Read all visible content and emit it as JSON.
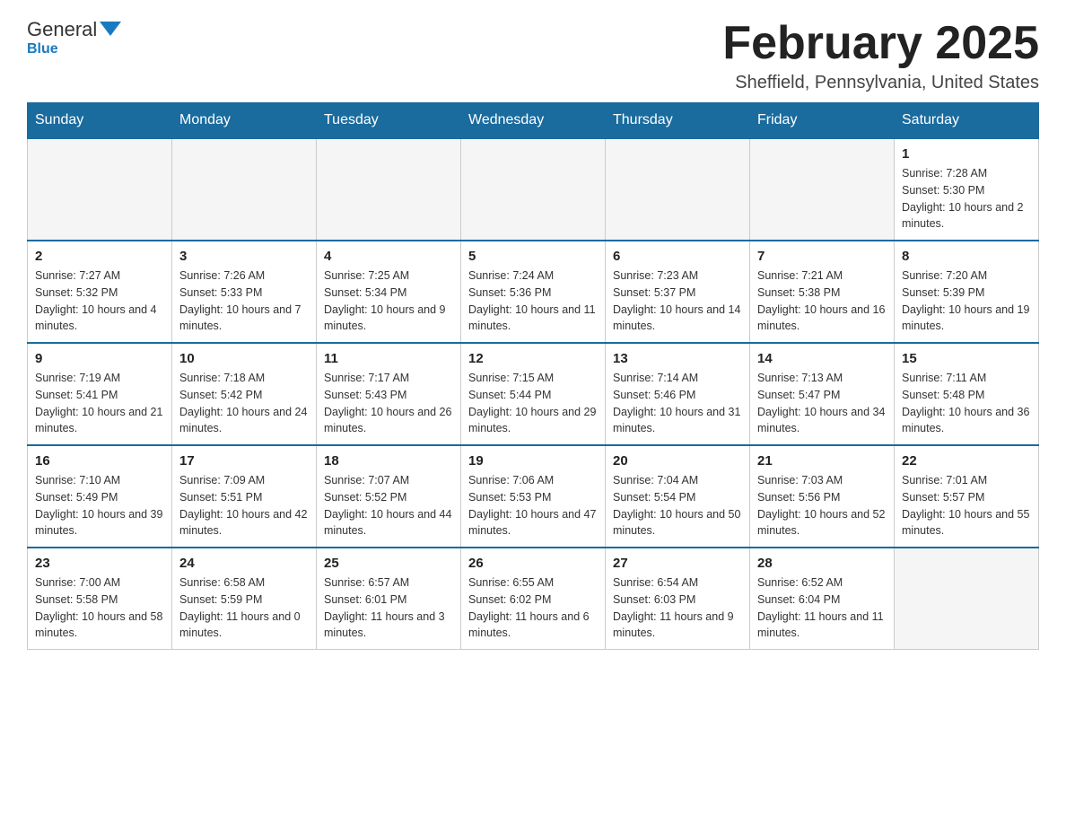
{
  "logo": {
    "general": "General",
    "blue": "Blue"
  },
  "title": "February 2025",
  "location": "Sheffield, Pennsylvania, United States",
  "days_of_week": [
    "Sunday",
    "Monday",
    "Tuesday",
    "Wednesday",
    "Thursday",
    "Friday",
    "Saturday"
  ],
  "weeks": [
    [
      {
        "day": "",
        "info": ""
      },
      {
        "day": "",
        "info": ""
      },
      {
        "day": "",
        "info": ""
      },
      {
        "day": "",
        "info": ""
      },
      {
        "day": "",
        "info": ""
      },
      {
        "day": "",
        "info": ""
      },
      {
        "day": "1",
        "info": "Sunrise: 7:28 AM\nSunset: 5:30 PM\nDaylight: 10 hours and 2 minutes."
      }
    ],
    [
      {
        "day": "2",
        "info": "Sunrise: 7:27 AM\nSunset: 5:32 PM\nDaylight: 10 hours and 4 minutes."
      },
      {
        "day": "3",
        "info": "Sunrise: 7:26 AM\nSunset: 5:33 PM\nDaylight: 10 hours and 7 minutes."
      },
      {
        "day": "4",
        "info": "Sunrise: 7:25 AM\nSunset: 5:34 PM\nDaylight: 10 hours and 9 minutes."
      },
      {
        "day": "5",
        "info": "Sunrise: 7:24 AM\nSunset: 5:36 PM\nDaylight: 10 hours and 11 minutes."
      },
      {
        "day": "6",
        "info": "Sunrise: 7:23 AM\nSunset: 5:37 PM\nDaylight: 10 hours and 14 minutes."
      },
      {
        "day": "7",
        "info": "Sunrise: 7:21 AM\nSunset: 5:38 PM\nDaylight: 10 hours and 16 minutes."
      },
      {
        "day": "8",
        "info": "Sunrise: 7:20 AM\nSunset: 5:39 PM\nDaylight: 10 hours and 19 minutes."
      }
    ],
    [
      {
        "day": "9",
        "info": "Sunrise: 7:19 AM\nSunset: 5:41 PM\nDaylight: 10 hours and 21 minutes."
      },
      {
        "day": "10",
        "info": "Sunrise: 7:18 AM\nSunset: 5:42 PM\nDaylight: 10 hours and 24 minutes."
      },
      {
        "day": "11",
        "info": "Sunrise: 7:17 AM\nSunset: 5:43 PM\nDaylight: 10 hours and 26 minutes."
      },
      {
        "day": "12",
        "info": "Sunrise: 7:15 AM\nSunset: 5:44 PM\nDaylight: 10 hours and 29 minutes."
      },
      {
        "day": "13",
        "info": "Sunrise: 7:14 AM\nSunset: 5:46 PM\nDaylight: 10 hours and 31 minutes."
      },
      {
        "day": "14",
        "info": "Sunrise: 7:13 AM\nSunset: 5:47 PM\nDaylight: 10 hours and 34 minutes."
      },
      {
        "day": "15",
        "info": "Sunrise: 7:11 AM\nSunset: 5:48 PM\nDaylight: 10 hours and 36 minutes."
      }
    ],
    [
      {
        "day": "16",
        "info": "Sunrise: 7:10 AM\nSunset: 5:49 PM\nDaylight: 10 hours and 39 minutes."
      },
      {
        "day": "17",
        "info": "Sunrise: 7:09 AM\nSunset: 5:51 PM\nDaylight: 10 hours and 42 minutes."
      },
      {
        "day": "18",
        "info": "Sunrise: 7:07 AM\nSunset: 5:52 PM\nDaylight: 10 hours and 44 minutes."
      },
      {
        "day": "19",
        "info": "Sunrise: 7:06 AM\nSunset: 5:53 PM\nDaylight: 10 hours and 47 minutes."
      },
      {
        "day": "20",
        "info": "Sunrise: 7:04 AM\nSunset: 5:54 PM\nDaylight: 10 hours and 50 minutes."
      },
      {
        "day": "21",
        "info": "Sunrise: 7:03 AM\nSunset: 5:56 PM\nDaylight: 10 hours and 52 minutes."
      },
      {
        "day": "22",
        "info": "Sunrise: 7:01 AM\nSunset: 5:57 PM\nDaylight: 10 hours and 55 minutes."
      }
    ],
    [
      {
        "day": "23",
        "info": "Sunrise: 7:00 AM\nSunset: 5:58 PM\nDaylight: 10 hours and 58 minutes."
      },
      {
        "day": "24",
        "info": "Sunrise: 6:58 AM\nSunset: 5:59 PM\nDaylight: 11 hours and 0 minutes."
      },
      {
        "day": "25",
        "info": "Sunrise: 6:57 AM\nSunset: 6:01 PM\nDaylight: 11 hours and 3 minutes."
      },
      {
        "day": "26",
        "info": "Sunrise: 6:55 AM\nSunset: 6:02 PM\nDaylight: 11 hours and 6 minutes."
      },
      {
        "day": "27",
        "info": "Sunrise: 6:54 AM\nSunset: 6:03 PM\nDaylight: 11 hours and 9 minutes."
      },
      {
        "day": "28",
        "info": "Sunrise: 6:52 AM\nSunset: 6:04 PM\nDaylight: 11 hours and 11 minutes."
      },
      {
        "day": "",
        "info": ""
      }
    ]
  ]
}
